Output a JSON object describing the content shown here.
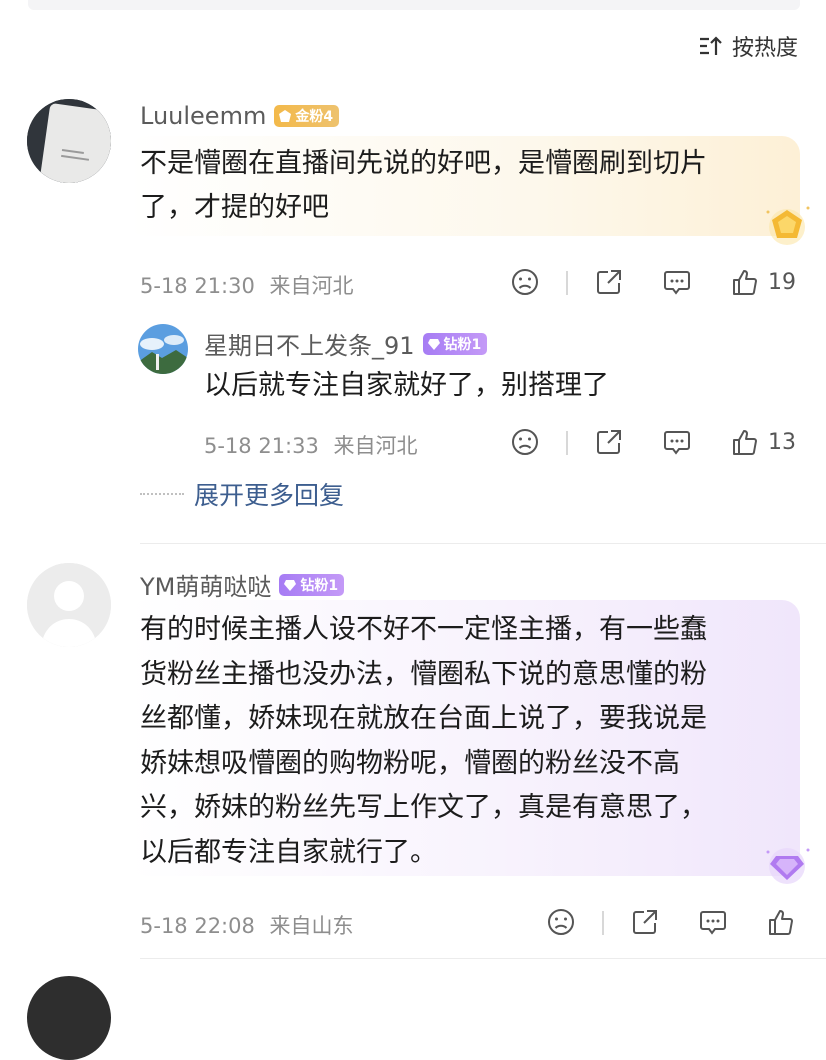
{
  "sort_label": "按热度",
  "comments": [
    {
      "username": "Luuleemm",
      "badge": "金粉4",
      "text": "不是懵圈在直播间先说的好吧，是懵圈刷到切片\n了，才提的好吧",
      "time": "5-18 21:30",
      "location": "来自河北",
      "likes": "19"
    },
    {
      "username": "星期日不上发条_91",
      "badge": "钻粉1",
      "text": "以后就专注自家就好了，别搭理了",
      "time": "5-18 21:33",
      "location": "来自河北",
      "likes": "13"
    },
    {
      "username": "YM萌萌哒哒",
      "badge": "钻粉1",
      "text": "有的时候主播人设不好不一定怪主播，有一些蠢\n货粉丝主播也没办法，懵圈私下说的意思懂的粉\n丝都懂，娇妹现在就放在台面上说了，要我说是\n娇妹想吸懵圈的购物粉呢，懵圈的粉丝没不高\n兴，娇妹的粉丝先写上作文了，真是有意思了，\n以后都专注自家就行了。",
      "time": "5-18 22:08",
      "location": "来自山东",
      "likes": ""
    }
  ],
  "expand_more": "展开更多回复",
  "colors": {
    "gold_badge": "#f3b94a",
    "diamond_badge": "#a67cf4",
    "link": "#3d5e8f"
  },
  "icons": [
    "sort-icon",
    "dislike-icon",
    "share-icon",
    "comment-icon",
    "like-icon"
  ]
}
